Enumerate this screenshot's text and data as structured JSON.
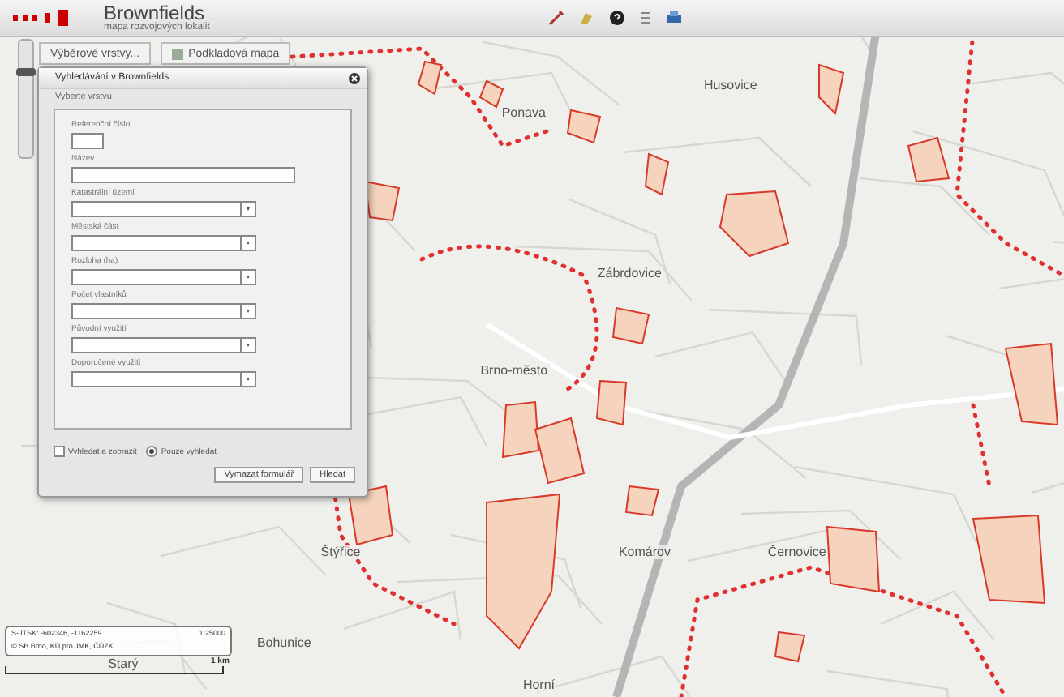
{
  "header": {
    "title": "Brownfields",
    "subtitle": "mapa rozvojových lokalit"
  },
  "toolbar_buttons": [
    {
      "label": "Výběrové vrstvy..."
    },
    {
      "label": "Podkladová mapa"
    }
  ],
  "zoom_slider": {
    "level": 0.75
  },
  "map_labels": [
    "Ponava",
    "Husovice",
    "Zábrdovice",
    "Brno-město",
    "Štýřice",
    "Komárov",
    "Černovice",
    "Bohunice",
    "Starý",
    "Horní"
  ],
  "dialog": {
    "title": "Vyhledávání v Brownfields",
    "layer_label": "Vyberte vrstvu",
    "fields": [
      {
        "label": "Referenční číslo",
        "kind": "short"
      },
      {
        "label": "Název",
        "kind": "text"
      },
      {
        "label": "Katastrální území",
        "kind": "select"
      },
      {
        "label": "Městská část",
        "kind": "select"
      },
      {
        "label": "Rozloha (ha)",
        "kind": "select"
      },
      {
        "label": "Počet vlastníků",
        "kind": "select"
      },
      {
        "label": "Původní využití",
        "kind": "select"
      },
      {
        "label": "Doporučené využití",
        "kind": "select"
      }
    ],
    "options": [
      {
        "label": "Vyhledat a zobrazit",
        "kind": "checkbox",
        "checked": false
      },
      {
        "label": "Pouze vyhledat",
        "kind": "radio",
        "checked": true
      }
    ],
    "buttons": [
      "Vymazat formulář",
      "Hledat"
    ]
  },
  "scale_box": {
    "coords": "S-JTSK: -602346, -1162259",
    "scale": "1:25000",
    "copyright": "© SB Brno, KÚ pro JMK, ČÚZK"
  },
  "scale_bar": {
    "label": "1 km"
  }
}
